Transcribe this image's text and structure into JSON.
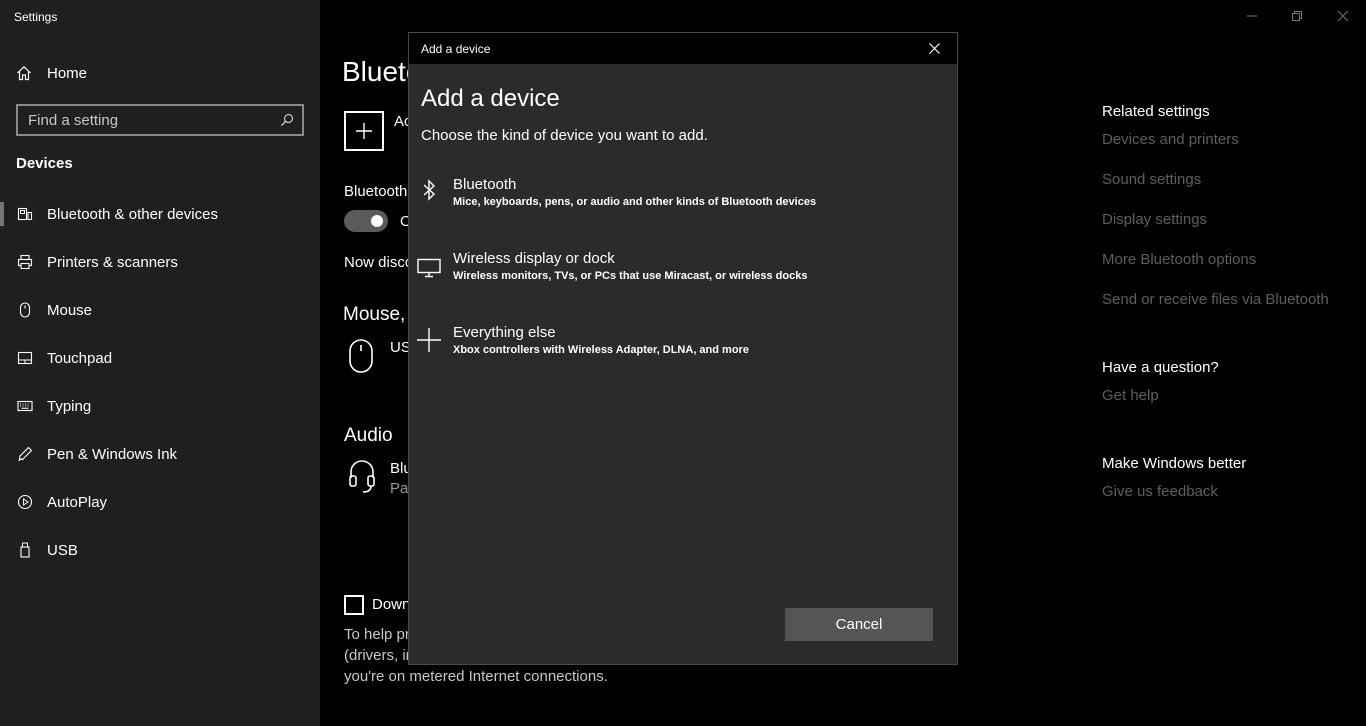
{
  "app": {
    "title": "Settings"
  },
  "sidebar": {
    "home_label": "Home",
    "search_placeholder": "Find a setting",
    "section_title": "Devices",
    "items": [
      {
        "label": "Bluetooth & other devices",
        "icon": "bluetooth-devices-icon"
      },
      {
        "label": "Printers & scanners",
        "icon": "printer-icon"
      },
      {
        "label": "Mouse",
        "icon": "mouse-icon"
      },
      {
        "label": "Touchpad",
        "icon": "touchpad-icon"
      },
      {
        "label": "Typing",
        "icon": "keyboard-icon"
      },
      {
        "label": "Pen & Windows Ink",
        "icon": "pen-icon"
      },
      {
        "label": "AutoPlay",
        "icon": "autoplay-icon"
      },
      {
        "label": "USB",
        "icon": "usb-icon"
      }
    ]
  },
  "main": {
    "title": "Blueto",
    "add_label": "Ac",
    "bluetooth_label": "Bluetooth",
    "toggle_label": "O",
    "now_discoverable": "Now disco",
    "mouse_heading": "Mouse,",
    "mouse_device": "US",
    "audio_heading": "Audio",
    "audio_device_name": "Blu",
    "audio_device_status": "Pai",
    "download_label": "Down",
    "help_lines": [
      "To help pr",
      "(drivers, ir",
      "you're on metered Internet connections."
    ]
  },
  "right": {
    "related_heading": "Related settings",
    "related_links": [
      "Devices and printers",
      "Sound settings",
      "Display settings",
      "More Bluetooth options",
      "Send or receive files via Bluetooth"
    ],
    "question_heading": "Have a question?",
    "question_link": "Get help",
    "better_heading": "Make Windows better",
    "better_link": "Give us feedback"
  },
  "dialog": {
    "title": "Add a device",
    "heading": "Add a device",
    "subtitle": "Choose the kind of device you want to add.",
    "options": [
      {
        "title": "Bluetooth",
        "desc": "Mice, keyboards, pens, or audio and other kinds of Bluetooth devices",
        "icon": "bluetooth-icon"
      },
      {
        "title": "Wireless display or dock",
        "desc": "Wireless monitors, TVs, or PCs that use Miracast, or wireless docks",
        "icon": "monitor-icon"
      },
      {
        "title": "Everything else",
        "desc": "Xbox controllers with Wireless Adapter, DLNA, and more",
        "icon": "plus-icon"
      }
    ],
    "cancel_label": "Cancel"
  },
  "colors": {
    "sidebar_bg": "#1f1f1f",
    "page_bg": "#000000",
    "dialog_bg": "#2b2b2b",
    "muted_link": "#5e5e5e",
    "button_bg": "#555555"
  }
}
